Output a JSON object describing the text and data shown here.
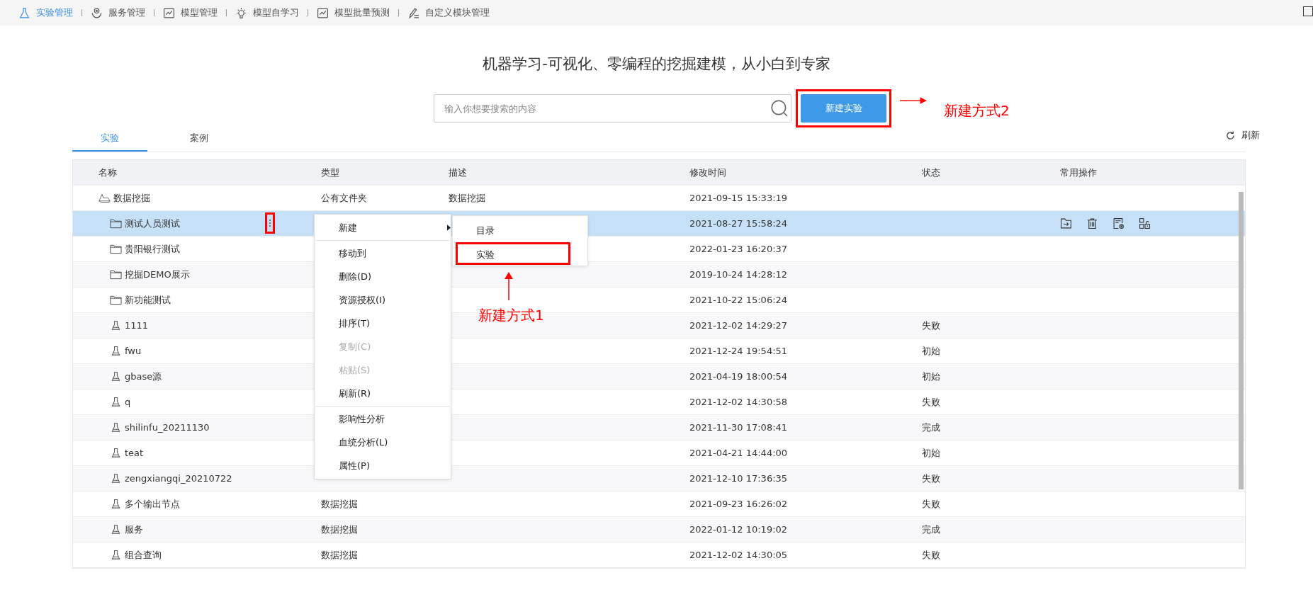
{
  "nav": [
    {
      "label": "实验管理",
      "selected": true
    },
    {
      "label": "服务管理",
      "selected": false
    },
    {
      "label": "模型管理",
      "selected": false
    },
    {
      "label": "模型自学习",
      "selected": false
    },
    {
      "label": "模型批量预测",
      "selected": false
    },
    {
      "label": "自定义模块管理",
      "selected": false
    }
  ],
  "headline": "机器学习-可视化、零编程的挖掘建模，从小白到专家",
  "search": {
    "placeholder": "输入你想要搜索的内容"
  },
  "new_button": {
    "label": "新建实验",
    "highlighted": true
  },
  "annotations": [
    {
      "text": "新建方式2",
      "kind": "right"
    },
    {
      "text": "新建方式1",
      "kind": "up"
    }
  ],
  "tabs": [
    {
      "label": "实验",
      "selected": true
    },
    {
      "label": "案例",
      "selected": false
    }
  ],
  "refresh": "刷新",
  "columns": [
    "名称",
    "类型",
    "描述",
    "修改时间",
    "状态",
    "常用操作"
  ],
  "rows": [
    {
      "name": "数据挖掘",
      "kind": "root",
      "type": "公有文件夹",
      "desc": "数据挖掘",
      "time": "2021-09-15 15:33:19",
      "selected": false,
      "children": [
        {
          "name": "测试人员测试",
          "kind": "folder",
          "time": "2021-08-27 15:58:24",
          "selected": true,
          "menu_highlighted": true
        },
        {
          "name": "贵阳银行测试",
          "kind": "folder",
          "time": "2022-01-23 16:20:37",
          "selected": false
        },
        {
          "name": "挖掘DEMO展示",
          "kind": "folder",
          "time": "2019-10-24 14:28:12",
          "selected": false
        },
        {
          "name": "新功能测试",
          "kind": "folder",
          "time": "2021-10-22 15:06:24",
          "selected": false
        },
        {
          "name": "1111",
          "kind": "experiment",
          "time": "2021-12-02 14:29:27",
          "status": "失败",
          "selected": false
        },
        {
          "name": "fwu",
          "kind": "experiment",
          "time": "2021-12-24 19:54:51",
          "status": "初始",
          "selected": false
        },
        {
          "name": "gbase源",
          "kind": "experiment",
          "time": "2021-04-19 18:00:54",
          "status": "初始",
          "selected": false
        },
        {
          "name": "q",
          "kind": "experiment",
          "time": "2021-12-02 14:30:58",
          "status": "失败",
          "selected": false
        },
        {
          "name": "shilinfu_20211130",
          "kind": "experiment",
          "time": "2021-11-30 17:08:41",
          "status": "完成",
          "selected": false
        },
        {
          "name": "teat",
          "kind": "experiment",
          "time": "2021-04-21 14:44:00",
          "status": "初始",
          "selected": false
        },
        {
          "name": "zengxiangqi_20210722",
          "kind": "experiment",
          "time": "2021-12-10 17:36:35",
          "status": "失败",
          "selected": false
        },
        {
          "name": "多个输出节点",
          "kind": "experiment",
          "type": "数据挖掘",
          "time": "2021-09-23 16:26:02",
          "status": "失败",
          "selected": false
        },
        {
          "name": "服务",
          "kind": "experiment",
          "type": "数据挖掘",
          "time": "2022-01-12 10:19:02",
          "status": "完成",
          "selected": false
        },
        {
          "name": "组合查询",
          "kind": "experiment",
          "type": "数据挖掘",
          "time": "2021-12-02 14:30:05",
          "status": "失败",
          "selected": false
        }
      ]
    }
  ],
  "context_menu": [
    {
      "label": "新建",
      "disabled": false,
      "submenu": true,
      "divider_after": true
    },
    {
      "label": "移动到",
      "disabled": false
    },
    {
      "label": "删除(D)",
      "disabled": false
    },
    {
      "label": "资源授权(I)",
      "disabled": false
    },
    {
      "label": "排序(T)",
      "disabled": false
    },
    {
      "label": "复制(C)",
      "disabled": true
    },
    {
      "label": "粘贴(S)",
      "disabled": true
    },
    {
      "label": "刷新(R)",
      "disabled": false,
      "divider_after": true
    },
    {
      "label": "影响性分析",
      "disabled": false
    },
    {
      "label": "血统分析(L)",
      "disabled": false
    },
    {
      "label": "属性(P)",
      "disabled": false
    }
  ],
  "submenu": [
    {
      "label": "目录",
      "highlighted": false
    },
    {
      "label": "实验",
      "highlighted": true
    }
  ]
}
